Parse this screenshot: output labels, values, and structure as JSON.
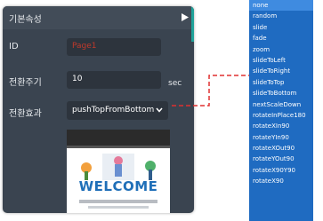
{
  "panel": {
    "title": "기본속성",
    "id_label": "ID",
    "id_value": "Page1",
    "interval_label": "전환주기",
    "interval_value": "10",
    "interval_unit": "sec",
    "effect_label": "전환효과",
    "effect_value": "pushTopFromBottom",
    "preview_heading": "WELCOME"
  },
  "dropdown": {
    "options": [
      "none",
      "random",
      "slide",
      "fade",
      "zoom",
      "slideToLeft",
      "slideToRight",
      "slideToTop",
      "slideToBottom",
      "nextScaleDown",
      "rotateInPlace180",
      "rotateXIn90",
      "rotateYIn90",
      "rotateXOut90",
      "rotateYOut90",
      "rotateX90Y90",
      "rotateX90"
    ],
    "highlighted_index": 0
  },
  "colors": {
    "panel_bg": "#3a4450",
    "accent": "#1fa39a",
    "id_text": "#c0392b",
    "dropdown_bg": "#1f6bc1",
    "connector": "#e03030"
  }
}
